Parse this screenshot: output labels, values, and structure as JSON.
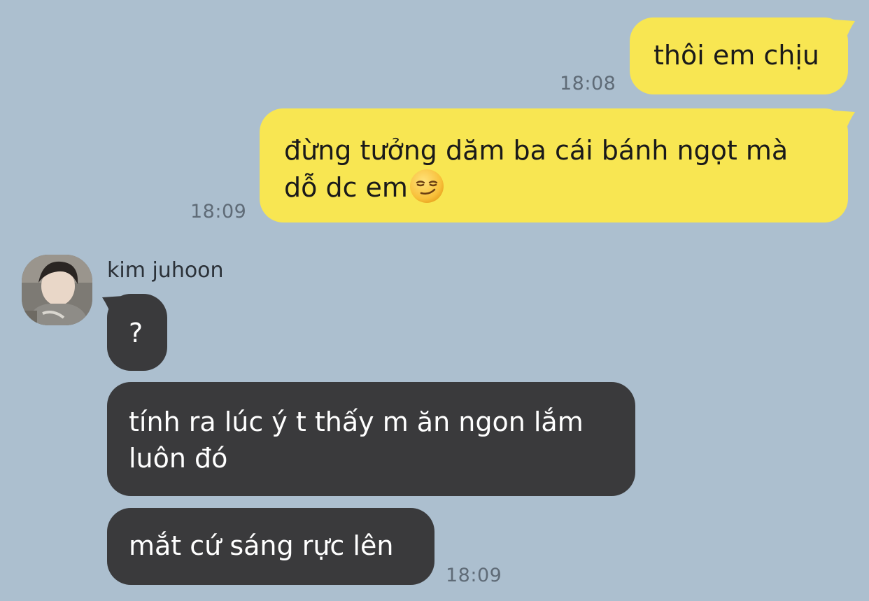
{
  "messages": {
    "m1": {
      "text": "thôi em chịu",
      "time": "18:08"
    },
    "m2": {
      "line1": "đừng tưởng dăm ba cái bánh ngọt mà",
      "line2": "dỗ dc em",
      "emoji": "smirking-face",
      "time": "18:09"
    },
    "sender": {
      "name": "kim juhoon",
      "avatar": "profile-photo"
    },
    "m3": {
      "text": "?"
    },
    "m4": {
      "line1": "tính ra lúc ý t thấy m ăn ngon lắm",
      "line2": "luôn đó"
    },
    "m5": {
      "text": "mắt cứ sáng rực lên",
      "time": "18:09"
    }
  },
  "colors": {
    "background": "#acbfcf",
    "my_bubble": "#f8e652",
    "their_bubble": "#3a3a3c",
    "timestamp": "#5f6b77"
  }
}
